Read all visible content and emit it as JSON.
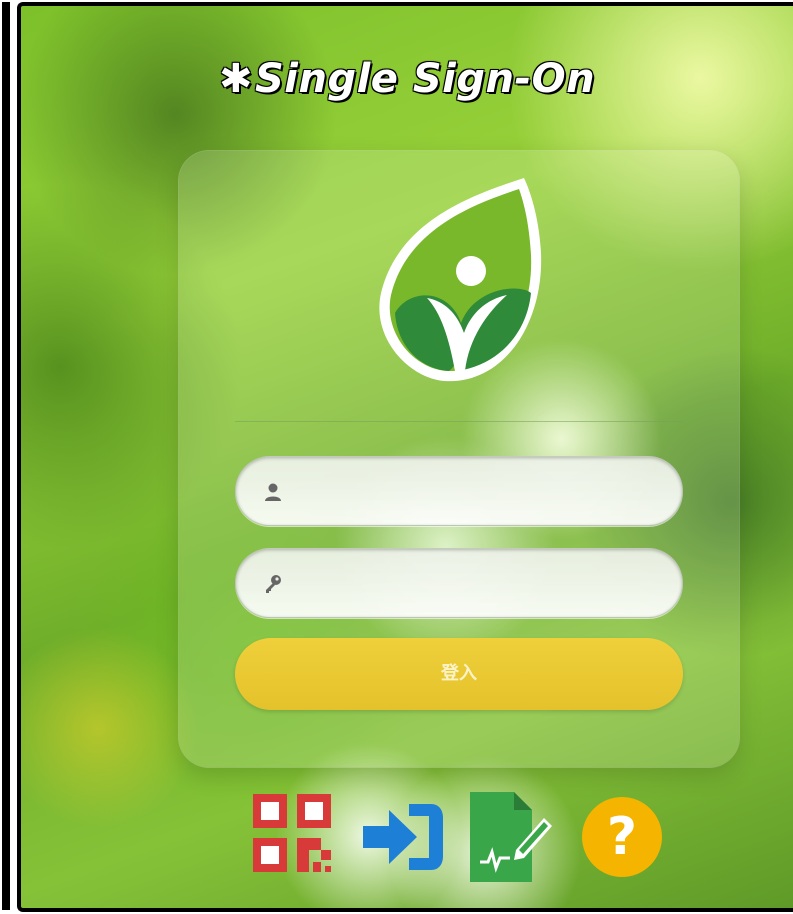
{
  "header": {
    "gear_glyph": "✱",
    "title": "Single Sign-On"
  },
  "login_form": {
    "username_placeholder": "",
    "password_placeholder": "",
    "submit_label": "登入"
  },
  "icons": {
    "logo": "leaf-person-logo-icon",
    "username": "user-icon",
    "password": "key-icon",
    "qr_login": "qr-code-icon",
    "sign_in": "sign-in-arrow-icon",
    "document": "document-edit-icon",
    "help": "help-question-icon"
  },
  "colors": {
    "login_button": "#e9c730",
    "login_text": "#fbf3c8",
    "qr_red": "#d83a3a",
    "signin_blue": "#1e7fd6",
    "doc_green": "#3aa64a",
    "help_yellow": "#f5b400"
  }
}
